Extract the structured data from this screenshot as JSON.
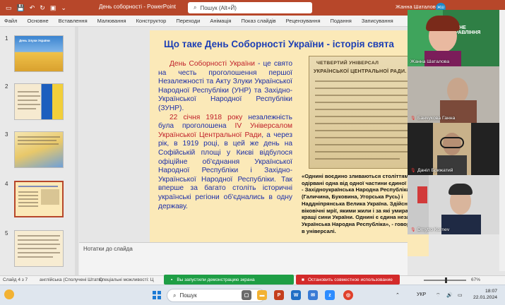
{
  "window": {
    "title": "День соборності  -  PowerPoint",
    "search_placeholder": "Пошук (Alt+Й)",
    "user_name": "Жанна Шаталова",
    "user_initials": "ЖШ"
  },
  "ribbon": {
    "tabs": [
      "Файл",
      "Основне",
      "Вставлення",
      "Малювання",
      "Конструктор",
      "Переходи",
      "Анімація",
      "Показ слайдів",
      "Рецензування",
      "Подання",
      "Записування"
    ]
  },
  "thumbnails": {
    "items": [
      {
        "number": "1",
        "title": "День Злуки України"
      },
      {
        "number": "2",
        "title": ""
      },
      {
        "number": "3",
        "title": ""
      },
      {
        "number": "4",
        "title": ""
      },
      {
        "number": "5",
        "title": ""
      }
    ],
    "selected": "4"
  },
  "slide": {
    "title": "Що таке День Соборності України - історія свята",
    "para1_red": "День Соборності України",
    "para1_rest": " - це свято на честь проголошення першої Незалежності та Акту Злуки Української Народної Республіки (УНР) та Західно-Української Народної Республіки (ЗУНР).",
    "para2_red1": "22 січня 1918 року",
    "para2_mid1": " незалежність була проголошена ",
    "para2_red2": "IV Універсалом Української Центральної Ради",
    "para2_rest": ", а через рік, в 1919 році, в цей же день на Софійській площі у Києві відбулося офіційне об'єднання Української Народної Республіки і Західно-Української Народної Республіки. Так вперше за багато століть історичні українські регіони об'єднались в одну державу.",
    "doc_header": "ЧЕТВЕРТИЙ УНІВЕРСАЛ",
    "doc_header2": "УКРАЇНСЬКОЇ ЦЕНТРАЛЬНОЇ РАДИ.",
    "quote": "«Однині воєдино зливаються століттями одірвані одна від одної частини єдиної України - Західноукраїнська Народна Республіка (Галичина, Буковина, Угорська Русь) і Наддніпрянська Велика Україна. Здійснились віковічні мрії, якими жили і за які умирали кращі сини України. Однині є єдина незалежна Українська Народна Республіка», - говорилося в універсалі."
  },
  "notes": {
    "placeholder": "Нотатки до слайда"
  },
  "participants": [
    {
      "name": "Жанна Шаталова",
      "banner": "АЛЬНЕ УПРАВЛІННЯ"
    },
    {
      "name": "Банчукова Ганна"
    },
    {
      "name": "Даніл Брижатий"
    },
    {
      "name": "Dmytro Kornev"
    }
  ],
  "sharing": {
    "green_label": "Вы запустили демонстрацию экрана",
    "red_label": "Остановить совместное использование"
  },
  "status_bar": {
    "slide_info": "Слайд 4 з 7",
    "language": "англійська (Сполучені Штати)",
    "accessibility": "Спеціальні можливості: Ц",
    "zoom": "67%"
  },
  "taskbar": {
    "search_text": "Пошук",
    "language": "УКР",
    "time": "18:07",
    "date": "22.01.2024"
  },
  "colors": {
    "accent": "#b7472a",
    "slide_bg": "#fbe9b8",
    "title_blue": "#1d3fb5",
    "highlight_red": "#c0202a"
  }
}
